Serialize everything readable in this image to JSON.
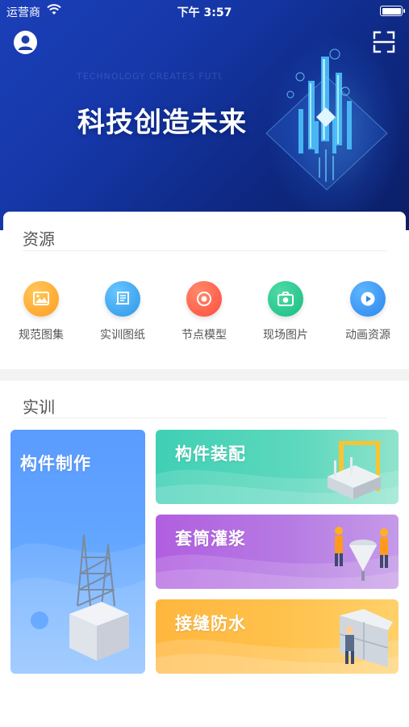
{
  "status_bar": {
    "carrier": "运营商",
    "time": "下午 3:57"
  },
  "hero": {
    "slogan": "科技创造未来",
    "faint_caption": "TECHNOLOGY CREATES FUTURE"
  },
  "resources": {
    "title": "资源",
    "items": [
      {
        "label": "规范图集",
        "icon": "image-gallery-icon",
        "color": "#ffa92b"
      },
      {
        "label": "实训图纸",
        "icon": "drawing-scroll-icon",
        "color": "#3aa7ee"
      },
      {
        "label": "节点模型",
        "icon": "node-model-icon",
        "color": "#ff5a48"
      },
      {
        "label": "现场图片",
        "icon": "camera-icon",
        "color": "#23c890"
      },
      {
        "label": "动画资源",
        "icon": "play-icon",
        "color": "#2f93f0"
      }
    ]
  },
  "training": {
    "title": "实训",
    "cards": [
      {
        "label": "构件制作",
        "color": "#5a9bff"
      },
      {
        "label": "构件装配",
        "color": "#3fd0b4"
      },
      {
        "label": "套筒灌浆",
        "color": "#b15ee0"
      },
      {
        "label": "接缝防水",
        "color": "#ffb63d"
      }
    ]
  }
}
